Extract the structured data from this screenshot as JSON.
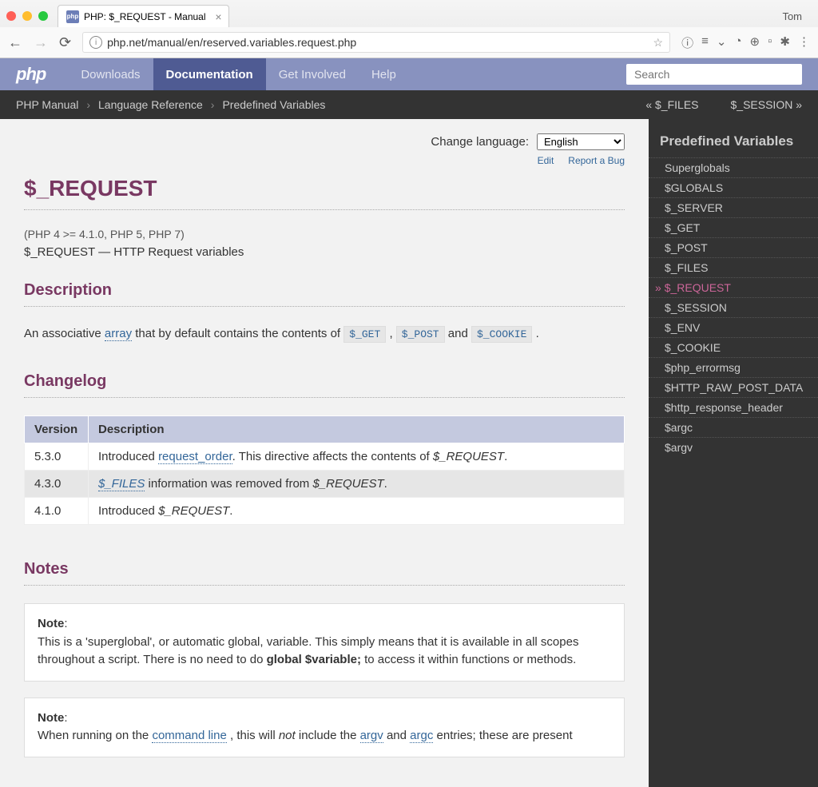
{
  "browser": {
    "tab_title": "PHP: $_REQUEST - Manual",
    "favicon": "php",
    "user": "Tom",
    "url": "php.net/manual/en/reserved.variables.request.php"
  },
  "header": {
    "logo": "php",
    "nav": [
      "Downloads",
      "Documentation",
      "Get Involved",
      "Help"
    ],
    "active_nav": "Documentation",
    "search_placeholder": "Search"
  },
  "breadcrumb": {
    "items": [
      "PHP Manual",
      "Language Reference",
      "Predefined Variables"
    ],
    "prev": "« $_FILES",
    "next": "$_SESSION »"
  },
  "page": {
    "change_lang_label": "Change language:",
    "lang_selected": "English",
    "edit": "Edit",
    "report": "Report a Bug",
    "title": "$_REQUEST",
    "verinfo": "(PHP 4 >= 4.1.0, PHP 5, PHP 7)",
    "refname": "$_REQUEST — HTTP Request variables",
    "sections": {
      "description": "Description",
      "changelog": "Changelog",
      "notes": "Notes"
    },
    "desc": {
      "pre": "An associative ",
      "array": "array",
      "mid1": " that by default contains the contents of ",
      "get": "$_GET",
      "comma": " , ",
      "post": "$_POST",
      "and": " and ",
      "cookie": "$_COOKIE",
      "end": " ."
    },
    "changelog": {
      "th_version": "Version",
      "th_desc": "Description",
      "rows": [
        {
          "v": "5.3.0",
          "pre": "Introduced ",
          "link": "request_order",
          "post": ". This directive affects the contents of ",
          "var": "$_REQUEST",
          "end": "."
        },
        {
          "v": "4.3.0",
          "link": "$_FILES",
          "post": " information was removed from ",
          "var": "$_REQUEST",
          "end": "."
        },
        {
          "v": "4.1.0",
          "pre": "Introduced ",
          "var": "$_REQUEST",
          "end": "."
        }
      ]
    },
    "notes": {
      "label": "Note",
      "note1_a": "This is a 'superglobal', or automatic global, variable. This simply means that it is available in all scopes throughout a script. There is no need to do ",
      "note1_b": "global $variable;",
      "note1_c": " to access it within functions or methods.",
      "note2_a": "When running on the ",
      "note2_cmd": "command line",
      "note2_b": " , this will ",
      "note2_not": "not",
      "note2_c": " include the ",
      "note2_argv": "argv",
      "note2_d": " and ",
      "note2_argc": "argc",
      "note2_e": " entries; these are present"
    }
  },
  "sidebar": {
    "title": "Predefined Variables",
    "items": [
      "Superglobals",
      "$GLOBALS",
      "$_SERVER",
      "$_GET",
      "$_POST",
      "$_FILES",
      "$_REQUEST",
      "$_SESSION",
      "$_ENV",
      "$_COOKIE",
      "$php_errormsg",
      "$HTTP_RAW_POST_DATA",
      "$http_response_header",
      "$argc",
      "$argv"
    ],
    "current": "$_REQUEST"
  }
}
